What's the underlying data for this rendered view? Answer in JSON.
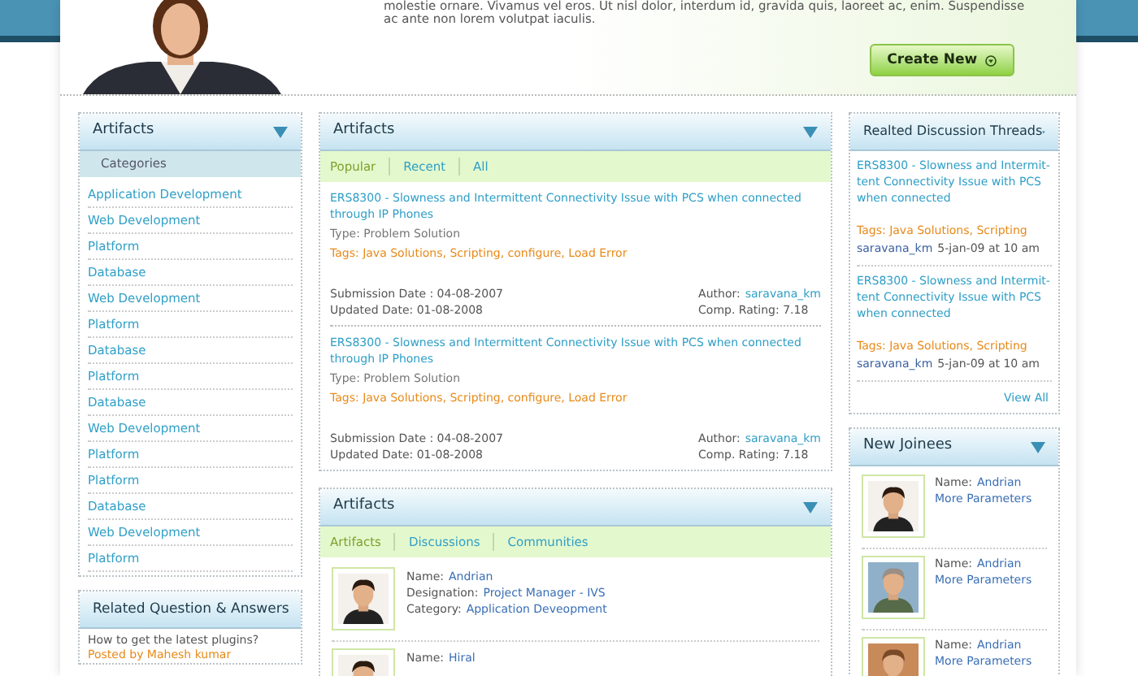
{
  "header": {
    "intro_lines": [
      "molestie ornare. Vivamus vel eros. Ut nisl dolor, interdum id, gravida quis, laoreet ac, enim. Suspendisse",
      "ac ante non lorem volutpat iaculis."
    ],
    "create_button": "Create New"
  },
  "left": {
    "artifacts": {
      "title": "Artifacts",
      "subtitle": "Categories",
      "items": [
        "Application Development",
        "Web Development",
        "Platform",
        "Database",
        "Web Development",
        "Platform",
        "Database",
        "Platform",
        "Database",
        "Web Development",
        "Platform",
        "Platform",
        "Database",
        "Web Development",
        "Platform"
      ]
    },
    "related_qa": {
      "title": "Related Question & Answers",
      "question": "How to get the latest plugins?",
      "posted_by": "Posted by Mahesh kumar"
    }
  },
  "middle": {
    "artifacts": {
      "title": "Artifacts",
      "tabs": [
        {
          "label": "Popular",
          "selected": true
        },
        {
          "label": "Recent",
          "selected": false
        },
        {
          "label": "All",
          "selected": false
        }
      ],
      "items": [
        {
          "title": "ERS8300 - Slowness and Intermittent Connectivity Issue with PCS when connected through IP Phones",
          "type": "Type: Problem Solution",
          "tags": "Tags: Java Solutions, Scripting, configure, Load Error",
          "submission": "Submission Date : 04-08-2007",
          "updated": "Updated Date: 01-08-2008",
          "author_label": "Author:",
          "author": "saravana_km",
          "rating": "Comp. Rating: 7.18"
        },
        {
          "title": "ERS8300 - Slowness and Intermittent Connectivity Issue with PCS when connected through IP Phones",
          "type": "Type: Problem Solution",
          "tags": "Tags: Java Solutions, Scripting, configure, Load Error",
          "submission": "Submission Date : 04-08-2007",
          "updated": "Updated Date: 01-08-2008",
          "author_label": "Author:",
          "author": "saravana_km",
          "rating": "Comp. Rating: 7.18"
        }
      ]
    },
    "people": {
      "title": "Artifacts",
      "tabs": [
        {
          "label": "Artifacts",
          "selected": true
        },
        {
          "label": "Discussions",
          "selected": false
        },
        {
          "label": "Communities",
          "selected": false
        }
      ],
      "members": [
        {
          "name_label": "Name:",
          "name": "Andrian",
          "designation_label": "Designation:",
          "designation": "Project Manager - IVS",
          "category_label": "Category:",
          "category": "Application Deveopment"
        },
        {
          "name_label": "Name:",
          "name": "Hiral"
        }
      ]
    }
  },
  "right": {
    "threads": {
      "title": "Realted Discussion Threads",
      "items": [
        {
          "title": "ERS8300 - Slowness and Intermit-tent Connectivity Issue with PCS when connected",
          "tags": "Tags: Java Solutions, Scripting",
          "author": "saravana_km",
          "time": "5-jan-09 at 10 am"
        },
        {
          "title": "ERS8300 - Slowness and Intermit-tent Connectivity Issue with PCS when connected",
          "tags": "Tags: Java Solutions, Scripting",
          "author": "saravana_km",
          "time": "5-jan-09 at 10 am"
        }
      ],
      "view_all": "View All"
    },
    "joinees": {
      "title": "New Joinees",
      "items": [
        {
          "name_label": "Name:",
          "name": "Andrian",
          "more": "More Parameters"
        },
        {
          "name_label": "Name:",
          "name": "Andrian",
          "more": "More Parameters"
        },
        {
          "name_label": "Name:",
          "name": "Andrian",
          "more": "More Parameters"
        }
      ]
    }
  }
}
